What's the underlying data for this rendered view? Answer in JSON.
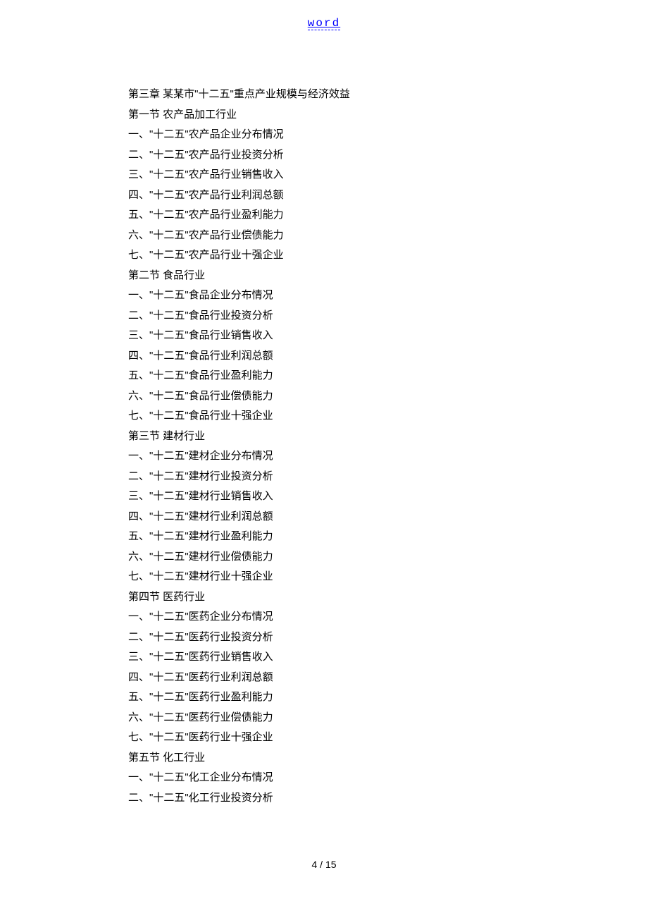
{
  "header": {
    "link_text": "word"
  },
  "toc": {
    "lines": [
      "第三章 某某市\"十二五\"重点产业规模与经济效益",
      "第一节 农产品加工行业",
      "一、\"十二五\"农产品企业分布情况",
      "二、\"十二五\"农产品行业投资分析",
      "三、\"十二五\"农产品行业销售收入",
      "四、\"十二五\"农产品行业利润总额",
      "五、\"十二五\"农产品行业盈利能力",
      "六、\"十二五\"农产品行业偿债能力",
      "七、\"十二五\"农产品行业十强企业",
      "第二节 食品行业",
      "一、\"十二五\"食品企业分布情况",
      "二、\"十二五\"食品行业投资分析",
      "三、\"十二五\"食品行业销售收入",
      "四、\"十二五\"食品行业利润总额",
      "五、\"十二五\"食品行业盈利能力",
      "六、\"十二五\"食品行业偿债能力",
      "七、\"十二五\"食品行业十强企业",
      "第三节 建材行业",
      "一、\"十二五\"建材企业分布情况",
      "二、\"十二五\"建材行业投资分析",
      "三、\"十二五\"建材行业销售收入",
      "四、\"十二五\"建材行业利润总额",
      "五、\"十二五\"建材行业盈利能力",
      "六、\"十二五\"建材行业偿债能力",
      "七、\"十二五\"建材行业十强企业",
      "第四节 医药行业",
      "一、\"十二五\"医药企业分布情况",
      "二、\"十二五\"医药行业投资分析",
      "三、\"十二五\"医药行业销售收入",
      "四、\"十二五\"医药行业利润总额",
      "五、\"十二五\"医药行业盈利能力",
      "六、\"十二五\"医药行业偿债能力",
      "七、\"十二五\"医药行业十强企业",
      "第五节 化工行业",
      "一、\"十二五\"化工企业分布情况",
      "二、\"十二五\"化工行业投资分析"
    ]
  },
  "footer": {
    "page_indicator": "4 / 15"
  }
}
